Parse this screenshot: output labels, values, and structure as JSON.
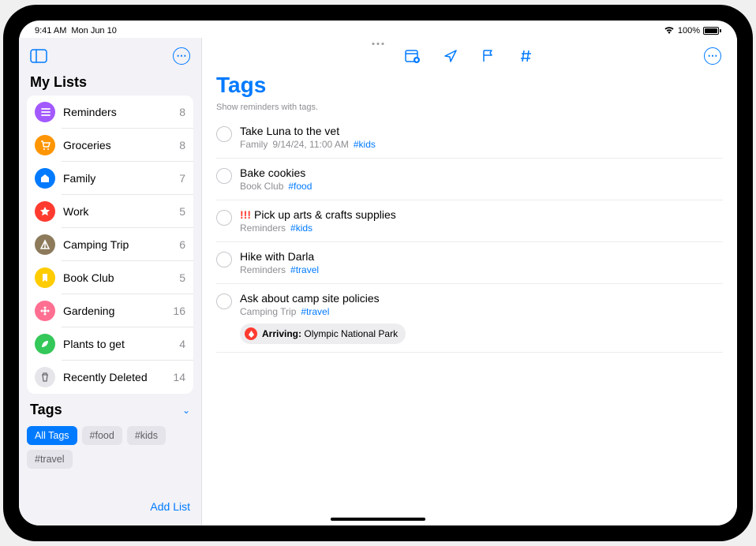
{
  "status": {
    "time": "9:41 AM",
    "date": "Mon Jun 10",
    "battery": "100%"
  },
  "sidebar": {
    "header": "My Lists",
    "lists": [
      {
        "name": "Reminders",
        "count": "8",
        "color": "#a259ff",
        "icon": "list"
      },
      {
        "name": "Groceries",
        "count": "8",
        "color": "#ff9500",
        "icon": "cart"
      },
      {
        "name": "Family",
        "count": "7",
        "color": "#007aff",
        "icon": "home"
      },
      {
        "name": "Work",
        "count": "5",
        "color": "#ff3b30",
        "icon": "star"
      },
      {
        "name": "Camping Trip",
        "count": "6",
        "color": "#8c7a5b",
        "icon": "tent"
      },
      {
        "name": "Book Club",
        "count": "5",
        "color": "#ffcc00",
        "icon": "bookmark"
      },
      {
        "name": "Gardening",
        "count": "16",
        "color": "#ff6f91",
        "icon": "flower"
      },
      {
        "name": "Plants to get",
        "count": "4",
        "color": "#34c759",
        "icon": "leaf"
      },
      {
        "name": "Recently Deleted",
        "count": "14",
        "color": "#c7c7cc",
        "icon": "trash"
      }
    ],
    "tags_header": "Tags",
    "tags": [
      {
        "label": "All Tags",
        "active": true
      },
      {
        "label": "#food",
        "active": false
      },
      {
        "label": "#kids",
        "active": false
      },
      {
        "label": "#travel",
        "active": false
      }
    ],
    "add_list": "Add List"
  },
  "main": {
    "title": "Tags",
    "subtitle": "Show reminders with tags.",
    "reminders": [
      {
        "title": "Take Luna to the vet",
        "list": "Family",
        "meta": "9/14/24, 11:00 AM",
        "tag": "#kids",
        "priority": ""
      },
      {
        "title": "Bake cookies",
        "list": "Book Club",
        "meta": "",
        "tag": "#food",
        "priority": ""
      },
      {
        "title": "Pick up arts & crafts supplies",
        "list": "Reminders",
        "meta": "",
        "tag": "#kids",
        "priority": "!!!"
      },
      {
        "title": "Hike with Darla",
        "list": "Reminders",
        "meta": "",
        "tag": "#travel",
        "priority": ""
      },
      {
        "title": "Ask about camp site policies",
        "list": "Camping Trip",
        "meta": "",
        "tag": "#travel",
        "priority": "",
        "location_label": "Arriving:",
        "location_value": "Olympic National Park"
      }
    ]
  }
}
